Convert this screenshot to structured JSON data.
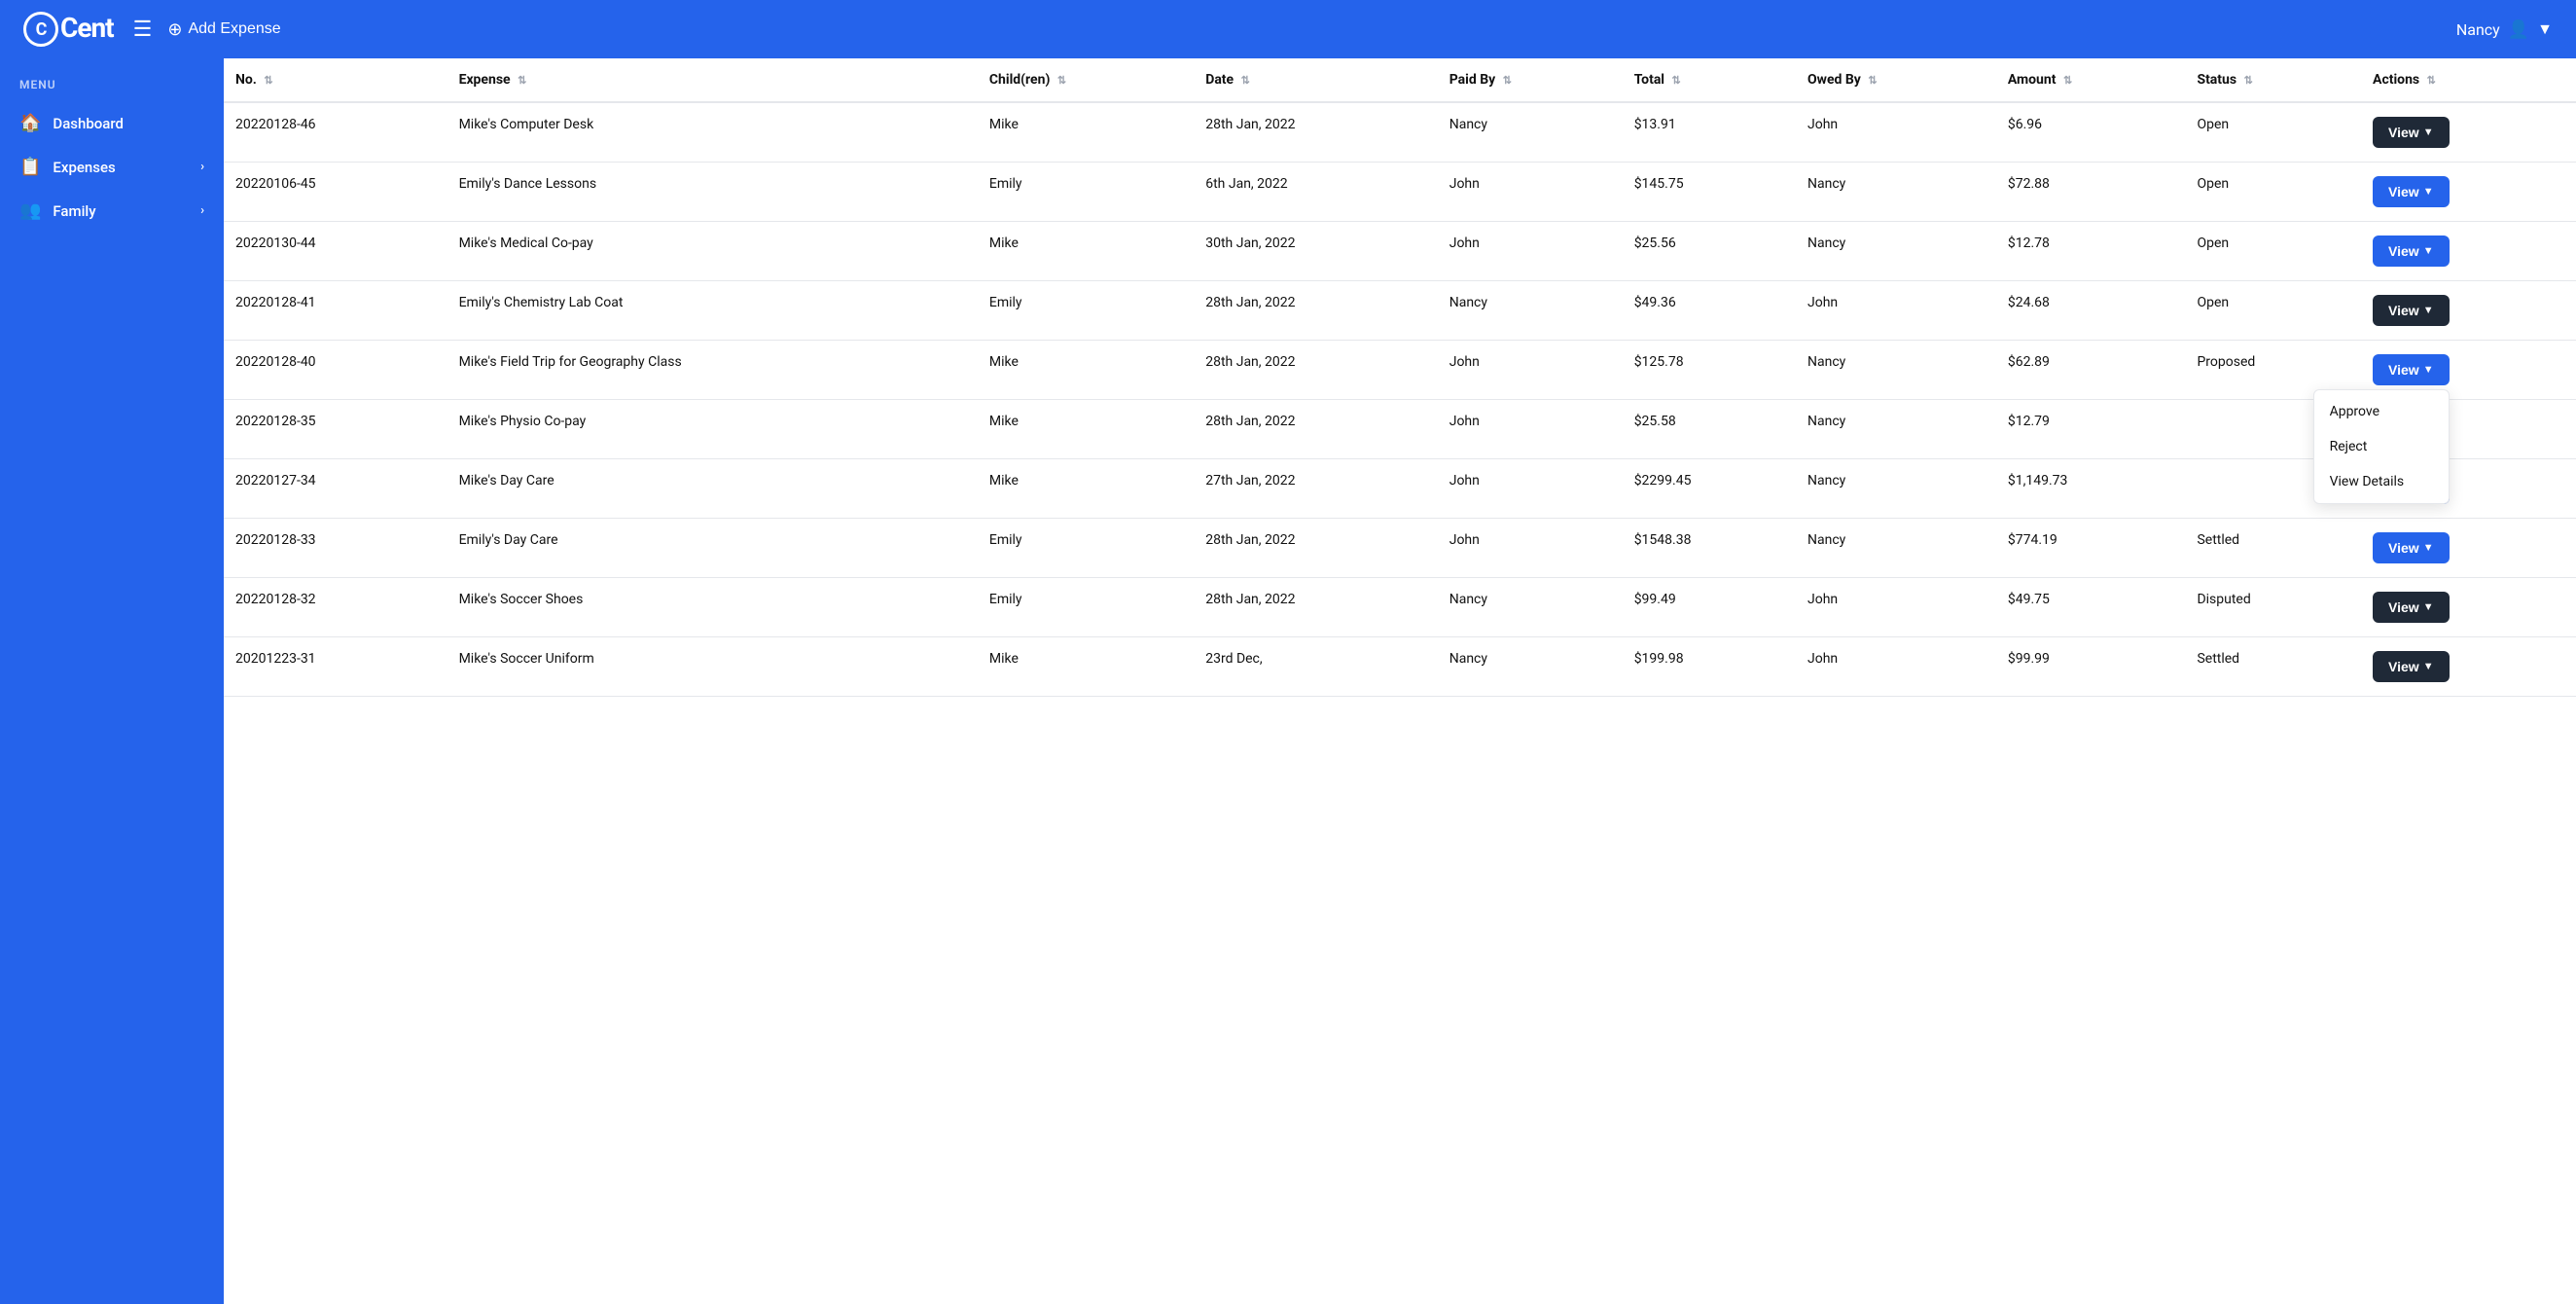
{
  "topnav": {
    "logo_text": "Cent",
    "add_expense_label": "Add Expense",
    "user_name": "Nancy"
  },
  "sidebar": {
    "menu_label": "MENU",
    "items": [
      {
        "id": "dashboard",
        "label": "Dashboard",
        "icon": "🏠",
        "has_chevron": false
      },
      {
        "id": "expenses",
        "label": "Expenses",
        "icon": "📋",
        "has_chevron": true
      },
      {
        "id": "family",
        "label": "Family",
        "icon": "👥",
        "has_chevron": true
      }
    ]
  },
  "table": {
    "columns": [
      {
        "key": "no",
        "label": "No."
      },
      {
        "key": "expense",
        "label": "Expense"
      },
      {
        "key": "children",
        "label": "Child(ren)"
      },
      {
        "key": "date",
        "label": "Date"
      },
      {
        "key": "paid_by",
        "label": "Paid By"
      },
      {
        "key": "total",
        "label": "Total"
      },
      {
        "key": "owed_by",
        "label": "Owed By"
      },
      {
        "key": "amount",
        "label": "Amount"
      },
      {
        "key": "status",
        "label": "Status"
      },
      {
        "key": "actions",
        "label": "Actions"
      }
    ],
    "rows": [
      {
        "no": "20220128-46",
        "expense": "Mike's Computer Desk",
        "children": "Mike",
        "date": "28th Jan, 2022",
        "paid_by": "Nancy",
        "total": "$13.91",
        "owed_by": "John",
        "amount": "$6.96",
        "status": "Open",
        "btn_style": "dark"
      },
      {
        "no": "20220106-45",
        "expense": "Emily's Dance Lessons",
        "children": "Emily",
        "date": "6th Jan, 2022",
        "paid_by": "John",
        "total": "$145.75",
        "owed_by": "Nancy",
        "amount": "$72.88",
        "status": "Open",
        "btn_style": "blue"
      },
      {
        "no": "20220130-44",
        "expense": "Mike's Medical Co-pay",
        "children": "Mike",
        "date": "30th Jan, 2022",
        "paid_by": "John",
        "total": "$25.56",
        "owed_by": "Nancy",
        "amount": "$12.78",
        "status": "Open",
        "btn_style": "blue"
      },
      {
        "no": "20220128-41",
        "expense": "Emily's Chemistry Lab Coat",
        "children": "Emily",
        "date": "28th Jan, 2022",
        "paid_by": "Nancy",
        "total": "$49.36",
        "owed_by": "John",
        "amount": "$24.68",
        "status": "Open",
        "btn_style": "dark"
      },
      {
        "no": "20220128-40",
        "expense": "Mike's Field Trip for Geography Class",
        "children": "Mike",
        "date": "28th Jan, 2022",
        "paid_by": "John",
        "total": "$125.78",
        "owed_by": "Nancy",
        "amount": "$62.89",
        "status": "Proposed",
        "btn_style": "active",
        "dropdown_open": true
      },
      {
        "no": "20220128-35",
        "expense": "Mike's Physio Co-pay",
        "children": "Mike",
        "date": "28th Jan, 2022",
        "paid_by": "John",
        "total": "$25.58",
        "owed_by": "Nancy",
        "amount": "$12.79",
        "status": "",
        "btn_style": "blue"
      },
      {
        "no": "20220127-34",
        "expense": "Mike's Day Care",
        "children": "Mike",
        "date": "27th Jan, 2022",
        "paid_by": "John",
        "total": "$2299.45",
        "owed_by": "Nancy",
        "amount": "$1,149.73",
        "status": "",
        "btn_style": "blue"
      },
      {
        "no": "20220128-33",
        "expense": "Emily's Day Care",
        "children": "Emily",
        "date": "28th Jan, 2022",
        "paid_by": "John",
        "total": "$1548.38",
        "owed_by": "Nancy",
        "amount": "$774.19",
        "status": "Settled",
        "btn_style": "blue"
      },
      {
        "no": "20220128-32",
        "expense": "Mike's Soccer Shoes",
        "children": "Emily",
        "date": "28th Jan, 2022",
        "paid_by": "Nancy",
        "total": "$99.49",
        "owed_by": "John",
        "amount": "$49.75",
        "status": "Disputed",
        "btn_style": "dark"
      },
      {
        "no": "20201223-31",
        "expense": "Mike's Soccer Uniform",
        "children": "Mike",
        "date": "23rd Dec,",
        "paid_by": "Nancy",
        "total": "$199.98",
        "owed_by": "John",
        "amount": "$99.99",
        "status": "Settled",
        "btn_style": "dark"
      }
    ],
    "dropdown": {
      "items": [
        "Approve",
        "Reject",
        "View Details"
      ]
    }
  }
}
